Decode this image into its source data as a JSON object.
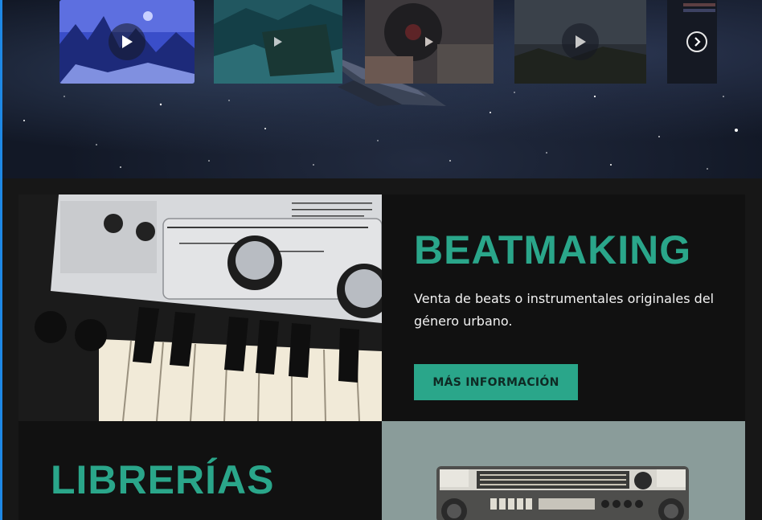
{
  "carousel": {
    "items": [
      {
        "name": "video-thumbnail-mountains",
        "active": true
      },
      {
        "name": "video-thumbnail-landscape",
        "active": false
      },
      {
        "name": "video-thumbnail-vinyl",
        "active": false
      },
      {
        "name": "video-thumbnail-dusk",
        "active": false
      },
      {
        "name": "video-thumbnail-text",
        "active": false
      }
    ],
    "icons": {
      "play": "play-icon",
      "next": "chevron-right-icon"
    },
    "accent_color": "#1e88e5"
  },
  "beatmaking": {
    "title": "BEATMAKING",
    "description": "Venta de beats o instrumentales originales del género urbano.",
    "button_label": "MÁS INFORMACIÓN",
    "image_label": "KORG microKORG XL"
  },
  "librerias": {
    "title": "LIBRERÍAS"
  },
  "colors": {
    "accent": "#2aa68a",
    "card_background": "#111111",
    "page_background": "#171717",
    "radio_panel": "#8a9c9a"
  }
}
